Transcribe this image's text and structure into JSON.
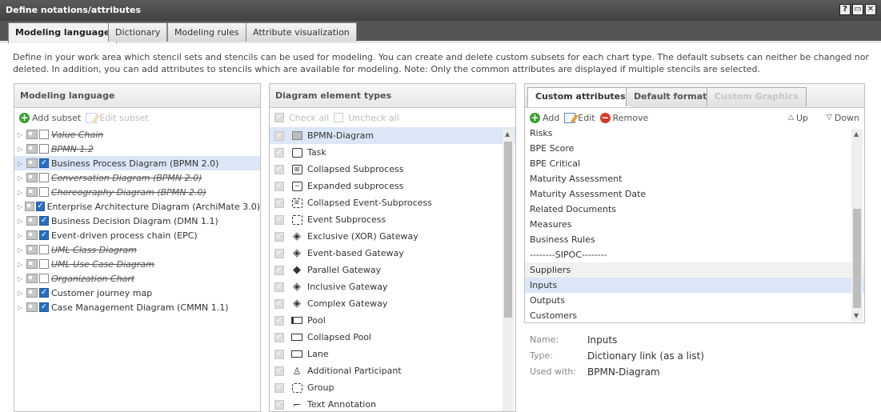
{
  "window": {
    "title": "Define notations/attributes",
    "buttons": [
      "?",
      "▭",
      "✕"
    ]
  },
  "tabs": [
    {
      "label": "Modeling language",
      "active": true
    },
    {
      "label": "Dictionary",
      "active": false
    },
    {
      "label": "Modeling rules",
      "active": false
    },
    {
      "label": "Attribute visualization",
      "active": false
    }
  ],
  "intro": "Define in your work area which stencil sets and stencils can be used for modeling. You can create and delete custom subsets for each chart type. The default subsets can neither be changed nor deleted. In addition, you can add attributes to stencils which are available for modeling. Note: Only the common attributes are displayed if multiple stencils are selected.",
  "modeling_panel": {
    "title": "Modeling language",
    "add_subset": "Add subset",
    "edit_subset": "Edit subset",
    "items": [
      {
        "label": "Value Chain",
        "checked": false,
        "strike": true,
        "selected": false
      },
      {
        "label": "BPMN 1.2",
        "checked": false,
        "strike": true,
        "selected": false
      },
      {
        "label": "Business Process Diagram (BPMN 2.0)",
        "checked": true,
        "strike": false,
        "selected": true
      },
      {
        "label": "Conversation Diagram (BPMN 2.0)",
        "checked": false,
        "strike": true,
        "selected": false
      },
      {
        "label": "Choreography Diagram (BPMN 2.0)",
        "checked": false,
        "strike": true,
        "selected": false
      },
      {
        "label": "Enterprise Architecture Diagram (ArchiMate 3.0)",
        "checked": true,
        "strike": false,
        "selected": false
      },
      {
        "label": "Business Decision Diagram (DMN 1.1)",
        "checked": true,
        "strike": false,
        "selected": false
      },
      {
        "label": "Event-driven process chain (EPC)",
        "checked": true,
        "strike": false,
        "selected": false
      },
      {
        "label": "UML Class Diagram",
        "checked": false,
        "strike": true,
        "selected": false
      },
      {
        "label": "UML Use Case Diagram",
        "checked": false,
        "strike": true,
        "selected": false
      },
      {
        "label": "Organization Chart",
        "checked": false,
        "strike": true,
        "selected": false
      },
      {
        "label": "Customer journey map",
        "checked": true,
        "strike": false,
        "selected": false
      },
      {
        "label": "Case Management Diagram (CMMN 1.1)",
        "checked": true,
        "strike": false,
        "selected": false
      }
    ]
  },
  "elements_panel": {
    "title": "Diagram element types",
    "check_all": "Check all",
    "uncheck_all": "Uncheck all",
    "items": [
      {
        "label": "BPMN-Diagram",
        "icon": "diagram-icon",
        "selected": true
      },
      {
        "label": "Task",
        "icon": "task-icon",
        "selected": false
      },
      {
        "label": "Collapsed Subprocess",
        "icon": "collapsed-subprocess-icon",
        "selected": false
      },
      {
        "label": "Expanded subprocess",
        "icon": "expanded-subprocess-icon",
        "selected": false
      },
      {
        "label": "Collapsed Event-Subprocess",
        "icon": "collapsed-event-subprocess-icon",
        "selected": false
      },
      {
        "label": "Event Subprocess",
        "icon": "event-subprocess-icon",
        "selected": false
      },
      {
        "label": "Exclusive (XOR) Gateway",
        "icon": "xor-gateway-icon",
        "selected": false
      },
      {
        "label": "Event-based Gateway",
        "icon": "event-gateway-icon",
        "selected": false
      },
      {
        "label": "Parallel Gateway",
        "icon": "parallel-gateway-icon",
        "selected": false
      },
      {
        "label": "Inclusive Gateway",
        "icon": "inclusive-gateway-icon",
        "selected": false
      },
      {
        "label": "Complex Gateway",
        "icon": "complex-gateway-icon",
        "selected": false
      },
      {
        "label": "Pool",
        "icon": "pool-icon",
        "selected": false
      },
      {
        "label": "Collapsed Pool",
        "icon": "collapsed-pool-icon",
        "selected": false
      },
      {
        "label": "Lane",
        "icon": "lane-icon",
        "selected": false
      },
      {
        "label": "Additional Participant",
        "icon": "participant-icon",
        "selected": false
      },
      {
        "label": "Group",
        "icon": "group-icon",
        "selected": false
      },
      {
        "label": "Text Annotation",
        "icon": "annotation-icon",
        "selected": false
      }
    ]
  },
  "attributes_panel": {
    "tabs": [
      {
        "label": "Custom attributes",
        "active": true,
        "disabled": false
      },
      {
        "label": "Default formats",
        "active": false,
        "disabled": false
      },
      {
        "label": "Custom Graphics",
        "active": false,
        "disabled": true
      }
    ],
    "add": "Add",
    "edit": "Edit",
    "remove": "Remove",
    "up": "Up",
    "down": "Down",
    "items": [
      {
        "label": "Risks",
        "band": false,
        "selected": false
      },
      {
        "label": "BPE Score",
        "band": false,
        "selected": false
      },
      {
        "label": "BPE Critical",
        "band": false,
        "selected": false
      },
      {
        "label": "Maturity Assessment",
        "band": false,
        "selected": false
      },
      {
        "label": "Maturity Assessment Date",
        "band": false,
        "selected": false
      },
      {
        "label": "Related Documents",
        "band": false,
        "selected": false
      },
      {
        "label": "Measures",
        "band": false,
        "selected": false
      },
      {
        "label": "Business Rules",
        "band": false,
        "selected": false
      },
      {
        "label": "--------SIPOC--------",
        "band": false,
        "selected": false
      },
      {
        "label": "Suppliers",
        "band": true,
        "selected": false
      },
      {
        "label": "Inputs",
        "band": false,
        "selected": true
      },
      {
        "label": "Outputs",
        "band": false,
        "selected": false
      },
      {
        "label": "Customers",
        "band": false,
        "selected": false
      }
    ],
    "details": {
      "name_label": "Name:",
      "name_value": "Inputs",
      "type_label": "Type:",
      "type_value": "Dictionary link (as a list)",
      "used_label": "Used with:",
      "used_value": "BPMN-Diagram"
    }
  }
}
